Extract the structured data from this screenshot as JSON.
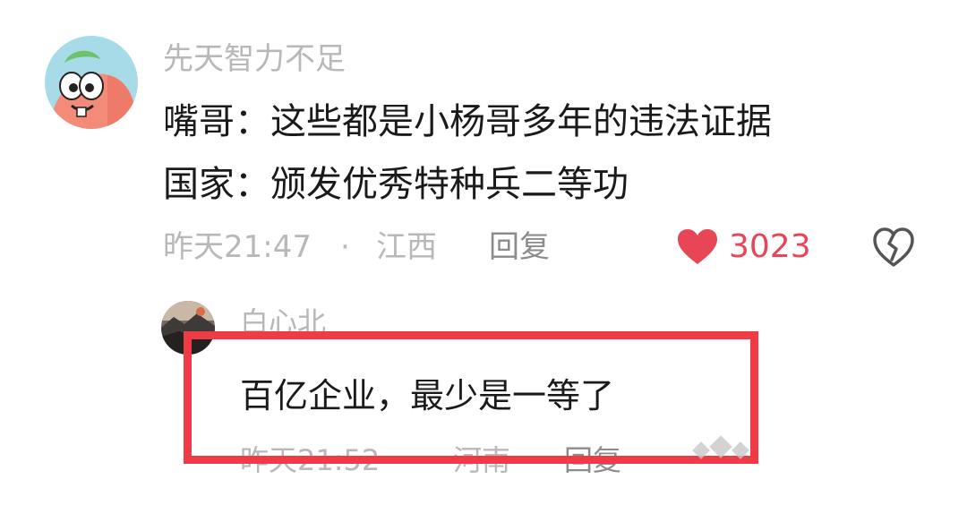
{
  "comment": {
    "username": "先天智力不足",
    "line1": "嘴哥：这些都是小杨哥多年的违法证据",
    "line2": "国家：颁发优秀特种兵二等功",
    "time": "昨天21:47",
    "separator": "·",
    "location": "江西",
    "reply_label": "回复",
    "like_count": "3023",
    "avatar_icon": "patrick-star-avatar",
    "like_icon": "heart-icon",
    "dislike_icon": "broken-heart-icon",
    "like_color": "#e84556"
  },
  "reply": {
    "username": "白心北",
    "text": "百亿企业，最少是一等了",
    "time": "昨天21:52",
    "separator": "·",
    "location": "河南",
    "reply_label": "回复",
    "avatar_icon": "landscape-avatar"
  },
  "annotation": {
    "box_color": "#ee3b46"
  }
}
